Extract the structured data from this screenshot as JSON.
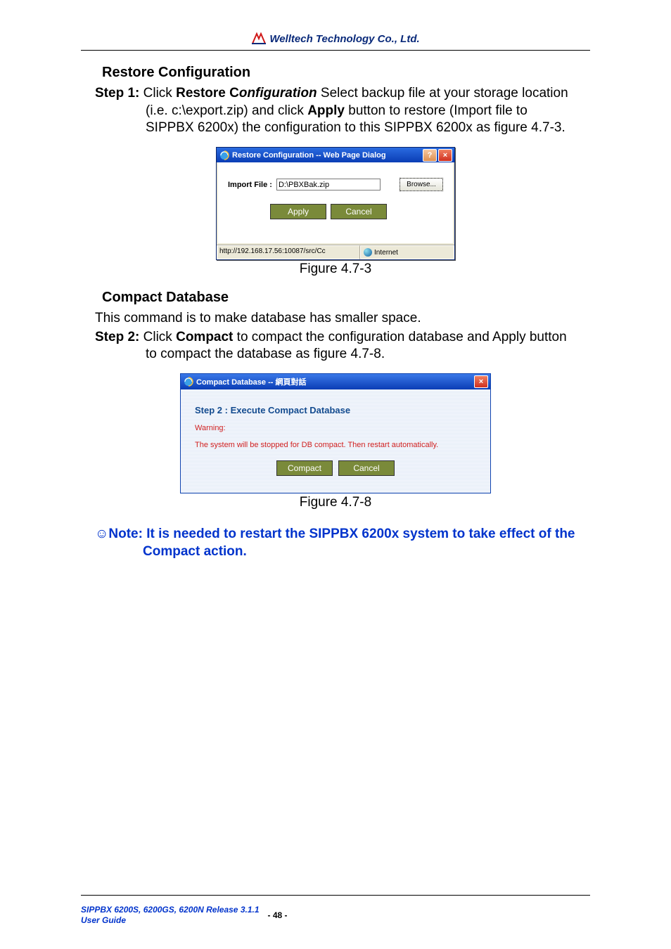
{
  "header": {
    "company": "Welltech Technology Co., Ltd."
  },
  "section1": {
    "title": "Restore Configuration",
    "step_label": "Step 1:",
    "step_text_1a": " Click ",
    "restore_c": "Restore C",
    "onfiguration": "onfiguration",
    "step_text_1b": " Select backup file at your storage location",
    "line2a": "(i.e. c:\\export.zip) and click ",
    "apply_word": "Apply",
    "line2b": " button to restore (Import file to",
    "line3": "SIPPBX 6200x) the configuration to this SIPPBX 6200x as figure 4.7-3.",
    "caption": "Figure 4.7-3"
  },
  "dialog1": {
    "title": "Restore Configuration -- Web Page Dialog",
    "help": "?",
    "close": "×",
    "import_label": "Import File :",
    "import_value": "D:\\PBXBak.zip",
    "browse": "Browse...",
    "apply": "Apply",
    "cancel": "Cancel",
    "status_url": "http://192.168.17.56:10087/src/Cc",
    "status_zone": "Internet"
  },
  "section2": {
    "title": "Compact Database",
    "desc": "This command is to make database has smaller space.",
    "step_label": "Step 2:",
    "step_text_a": " Click ",
    "compact_word": "Compact",
    "step_text_b": " to compact the configuration database and Apply button",
    "line2": "to compact the database as figure 4.7-8.",
    "caption": "Figure 4.7-8"
  },
  "dialog2": {
    "title": "Compact Database -- 網頁對話",
    "close": "×",
    "step_title": "Step 2 : Execute Compact Database",
    "warning_label": "Warning:",
    "warning_text": "The system will be stopped for DB compact. Then restart automatically.",
    "compact": "Compact",
    "cancel": "Cancel"
  },
  "note": {
    "symbol": "☺",
    "line1": "Note: It is needed to restart the SIPPBX 6200x system to take effect of the",
    "line2": "Compact action."
  },
  "footer": {
    "line1": "SIPPBX 6200S, 6200GS, 6200N   Release 3.1.1",
    "line2": "User Guide",
    "page": "- 48 -"
  }
}
